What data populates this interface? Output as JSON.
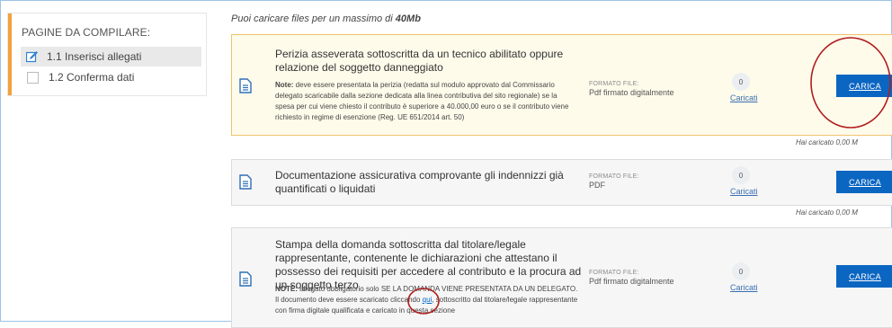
{
  "sidebar": {
    "title": "PAGINE DA COMPILARE:",
    "items": [
      {
        "label": "1.1 Inserisci allegati",
        "state": "active"
      },
      {
        "label": "1.2 Conferma dati",
        "state": "inactive"
      }
    ]
  },
  "upload_limit": {
    "prefix": "Puoi caricare files per un massimo di ",
    "value": "40Mb"
  },
  "documents": [
    {
      "title": "Perizia asseverata sottoscritta da un tecnico abilitato oppure relazione del soggetto danneggiato",
      "note_label": "Note:",
      "note_text": " deve essere presentata la perizia (redatta sul modulo approvato dal Commissario delegato scaricabile dalla sezione dedicata alla linea contributiva del sito regionale) se la spesa per cui viene chiesto il contributo è superiore a 40.000,00 euro o se il contributo viene richiesto in regime di esenzione (Reg. UE 651/2014 art. 50)",
      "format_label": "FORMATO FILE:",
      "format_value": "Pdf firmato digitalmente",
      "count": "0",
      "count_label": "Caricati",
      "button": "CARICA",
      "uploaded": "Hai caricato 0,00 M"
    },
    {
      "title": "Documentazione assicurativa comprovante gli indennizzi già quantificati o liquidati",
      "format_label": "FORMATO FILE:",
      "format_value": "PDF",
      "count": "0",
      "count_label": "Caricati",
      "button": "CARICA",
      "uploaded": "Hai caricato 0,00 M"
    },
    {
      "title": "Stampa della domanda sottoscritta dal titolare/legale rappresentante, contenente le dichiarazioni che attestano il possesso dei requisiti per accedere al contributo e la procura ad un soggetto terzo",
      "note_label": "NOTE:",
      "note_before": " allegato obbligatorio solo SE LA DOMANDA VIENE PRESENTATA DA UN DELEGATO. Il documento deve essere scaricato cliccando ",
      "note_link": "qui",
      "note_after": ", sottoscritto dal titolare/legale rappresentante con firma digitale qualificata e caricato in questa sezione",
      "format_label": "FORMATO FILE:",
      "format_value": "Pdf firmato digitalmente",
      "count": "0",
      "count_label": "Caricati",
      "button": "CARICA"
    }
  ],
  "colors": {
    "accent_button": "#0b66c2",
    "highlight_card_bg": "#fffbeb",
    "sidebar_accent": "#f0a23c",
    "annotation_circle": "#b01d1d"
  }
}
